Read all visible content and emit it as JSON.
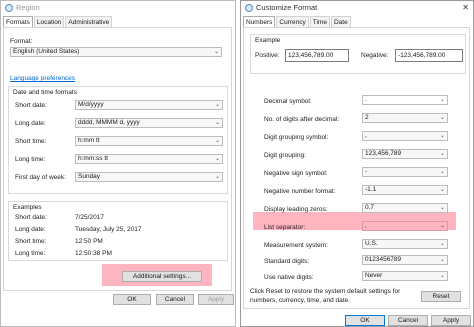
{
  "region": {
    "title": "Region",
    "tabs": [
      "Formats",
      "Location",
      "Administrative"
    ],
    "format_label": "Format:",
    "format_value": "English (United States)",
    "language_link": "Language preferences",
    "dt_group_title": "Date and time formats",
    "fields": [
      {
        "label": "Short date:",
        "value": "M/d/yyyy"
      },
      {
        "label": "Long date:",
        "value": "dddd, MMMM d, yyyy"
      },
      {
        "label": "Short time:",
        "value": "h:mm tt"
      },
      {
        "label": "Long time:",
        "value": "h:mm:ss tt"
      },
      {
        "label": "First day of week:",
        "value": "Sunday"
      }
    ],
    "examples_title": "Examples",
    "examples": [
      {
        "label": "Short date:",
        "value": "7/25/2017"
      },
      {
        "label": "Long date:",
        "value": "Tuesday, July 25, 2017"
      },
      {
        "label": "Short time:",
        "value": "12:50 PM"
      },
      {
        "label": "Long time:",
        "value": "12:50:38 PM"
      }
    ],
    "additional_settings": "Additional settings...",
    "ok": "OK",
    "cancel": "Cancel",
    "apply": "Apply"
  },
  "custom": {
    "title": "Customize Format",
    "tabs": [
      "Numbers",
      "Currency",
      "Time",
      "Date"
    ],
    "example_title": "Example",
    "positive_label": "Positive:",
    "positive_value": "123,456,789.00",
    "negative_label": "Negative:",
    "negative_value": "-123,456,789.00",
    "settings": [
      {
        "label": "Decimal symbol:",
        "value": "."
      },
      {
        "label": "No. of digits after decimal:",
        "value": "2"
      },
      {
        "label": "Digit grouping symbol:",
        "value": ","
      },
      {
        "label": "Digit grouping:",
        "value": "123,456,789"
      },
      {
        "label": "Negative sign symbol:",
        "value": "-"
      },
      {
        "label": "Negative number format:",
        "value": "-1.1"
      },
      {
        "label": "Display leading zeros:",
        "value": "0.7"
      },
      {
        "label": "List separator:",
        "value": ","
      },
      {
        "label": "Measurement system:",
        "value": "U.S."
      },
      {
        "label": "Standard digits:",
        "value": "0123456789"
      },
      {
        "label": "Use native digits:",
        "value": "Never"
      }
    ],
    "reset_text_1": "Click Reset to restore the system default settings for",
    "reset_text_2": "numbers, currency, time, and date.",
    "reset": "Reset",
    "ok": "OK",
    "cancel": "Cancel",
    "apply": "Apply"
  },
  "colors": {
    "highlight": "#ff7f8c",
    "link": "#0066cc",
    "focus": "#0078d7"
  }
}
